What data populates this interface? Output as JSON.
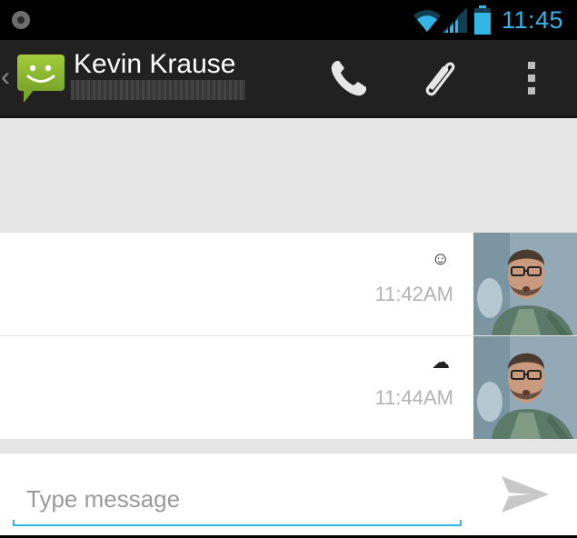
{
  "status_bar": {
    "time": "11:45",
    "icons": [
      "notification-icon",
      "wifi-icon",
      "signal-icon",
      "battery-icon"
    ],
    "accent_color": "#33b5e5"
  },
  "action_bar": {
    "contact_name": "Kevin Krause",
    "back_glyph": "‹",
    "icons": [
      "messaging-app-icon",
      "phone-icon",
      "paperclip-icon",
      "overflow-menu-icon"
    ],
    "background": "#212121"
  },
  "messages": [
    {
      "content": "☺",
      "time": "11:42AM",
      "avatar": "contact-photo"
    },
    {
      "content": "☁",
      "time": "11:44AM",
      "avatar": "contact-photo"
    }
  ],
  "composer": {
    "placeholder": "Type message",
    "send_icon": "send-icon"
  }
}
